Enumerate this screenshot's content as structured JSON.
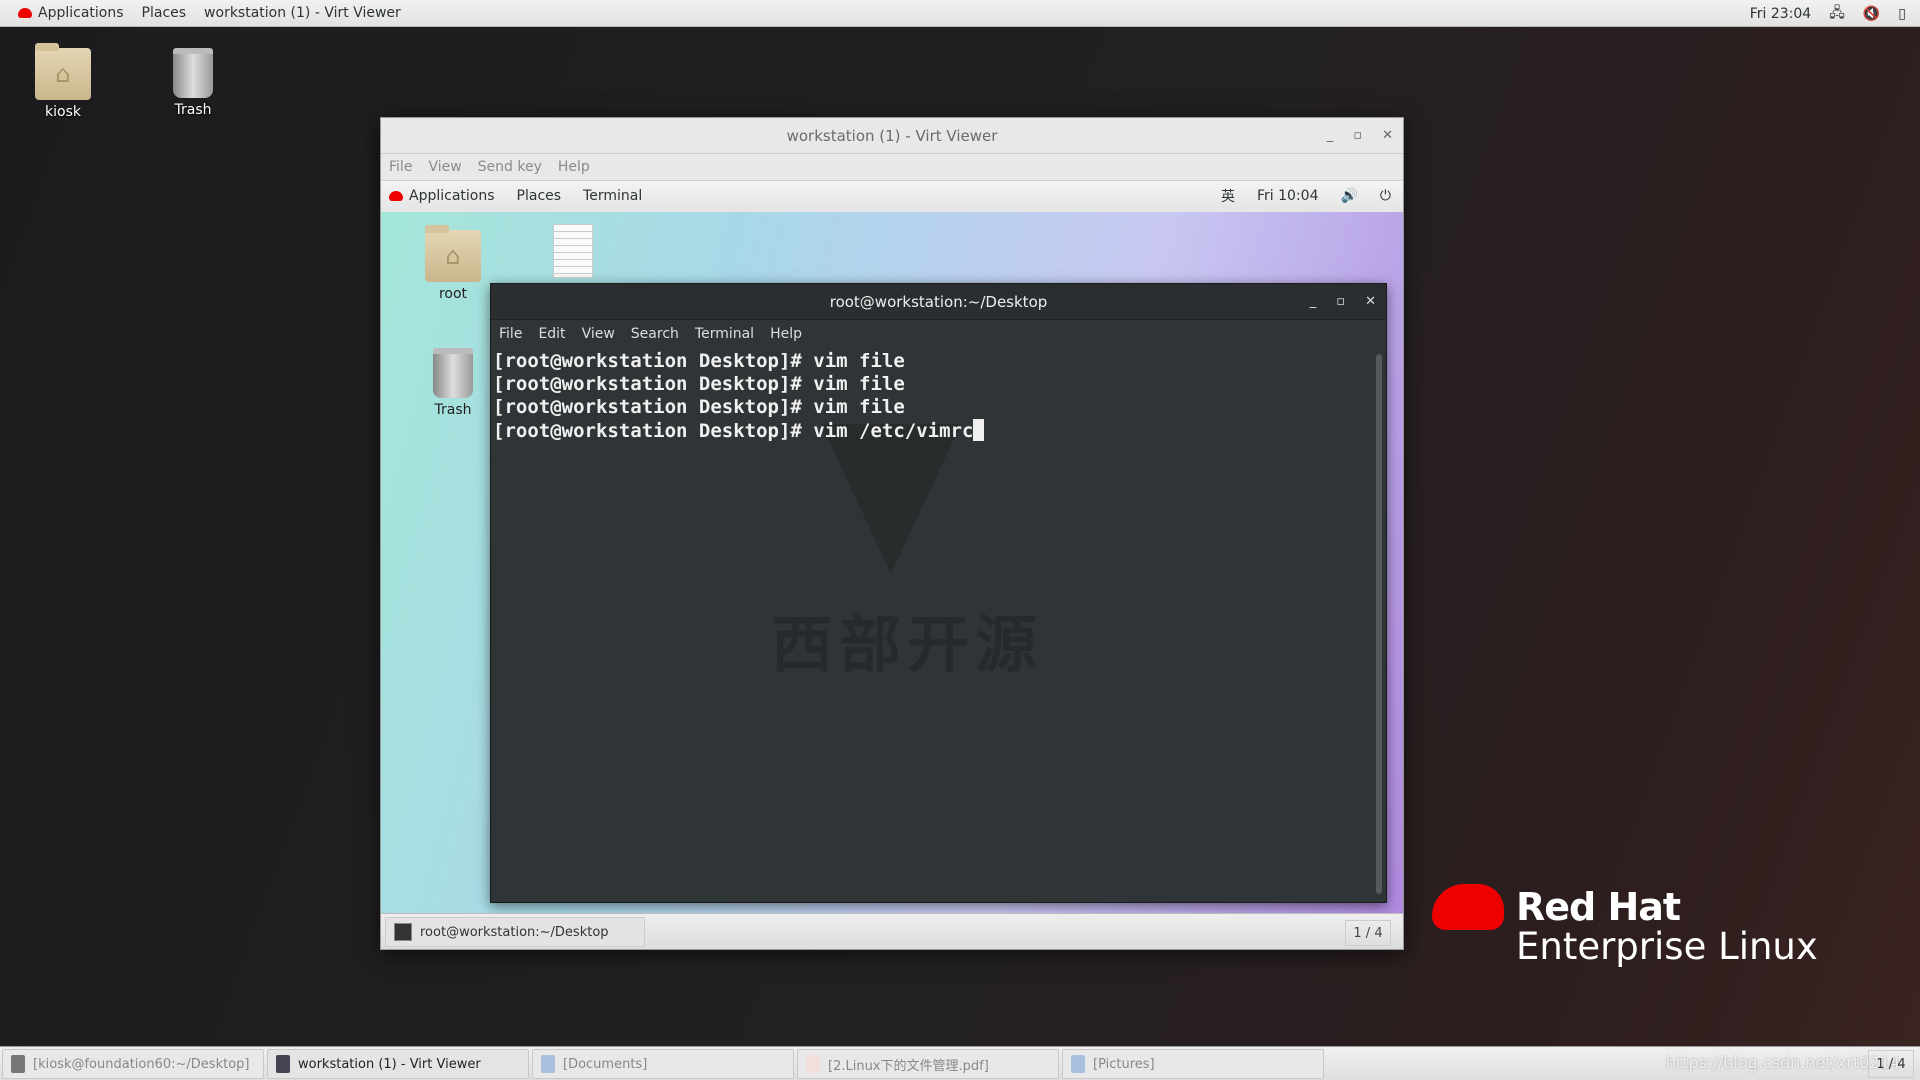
{
  "topbar": {
    "applications": "Applications",
    "places": "Places",
    "window": "workstation (1) - Virt Viewer",
    "clock": "Fri 23:04",
    "icons": [
      "network-icon",
      "volume-muted-icon",
      "battery-icon"
    ]
  },
  "desktop": {
    "icons": [
      {
        "label": "kiosk"
      },
      {
        "label": "Trash"
      }
    ]
  },
  "virt_viewer": {
    "title": "workstation (1) - Virt Viewer",
    "menu": [
      "File",
      "View",
      "Send key",
      "Help"
    ],
    "guest_top": {
      "applications": "Applications",
      "places": "Places",
      "terminal": "Terminal",
      "ime": "英",
      "clock": "Fri 10:04"
    },
    "guest_desktop": {
      "icons": [
        {
          "label": "root"
        },
        {
          "label": "Trash"
        }
      ]
    },
    "terminal": {
      "title": "root@workstation:~/Desktop",
      "menu": [
        "File",
        "Edit",
        "View",
        "Search",
        "Terminal",
        "Help"
      ],
      "lines": [
        "[root@workstation Desktop]# vim file",
        "[root@workstation Desktop]# vim file",
        "[root@workstation Desktop]# vim file",
        "[root@workstation Desktop]# vim /etc/vimrc"
      ],
      "watermark": "西部开源"
    },
    "guest_taskbar": {
      "item": "root@workstation:~/Desktop",
      "pager": "1 / 4"
    }
  },
  "branding": {
    "line1": "Red Hat",
    "line2": "Enterprise Linux",
    "color": "#ee0000"
  },
  "taskbar": {
    "items": [
      {
        "label": "[kiosk@foundation60:~/Desktop]"
      },
      {
        "label": "workstation (1) - Virt Viewer"
      },
      {
        "label": "[Documents]"
      },
      {
        "label": "[2.Linux下的文件管理.pdf]"
      },
      {
        "label": "[Pictures]"
      }
    ],
    "pager": "1 / 4",
    "watermark": "https://blog.csdn.net/xrt0214"
  }
}
